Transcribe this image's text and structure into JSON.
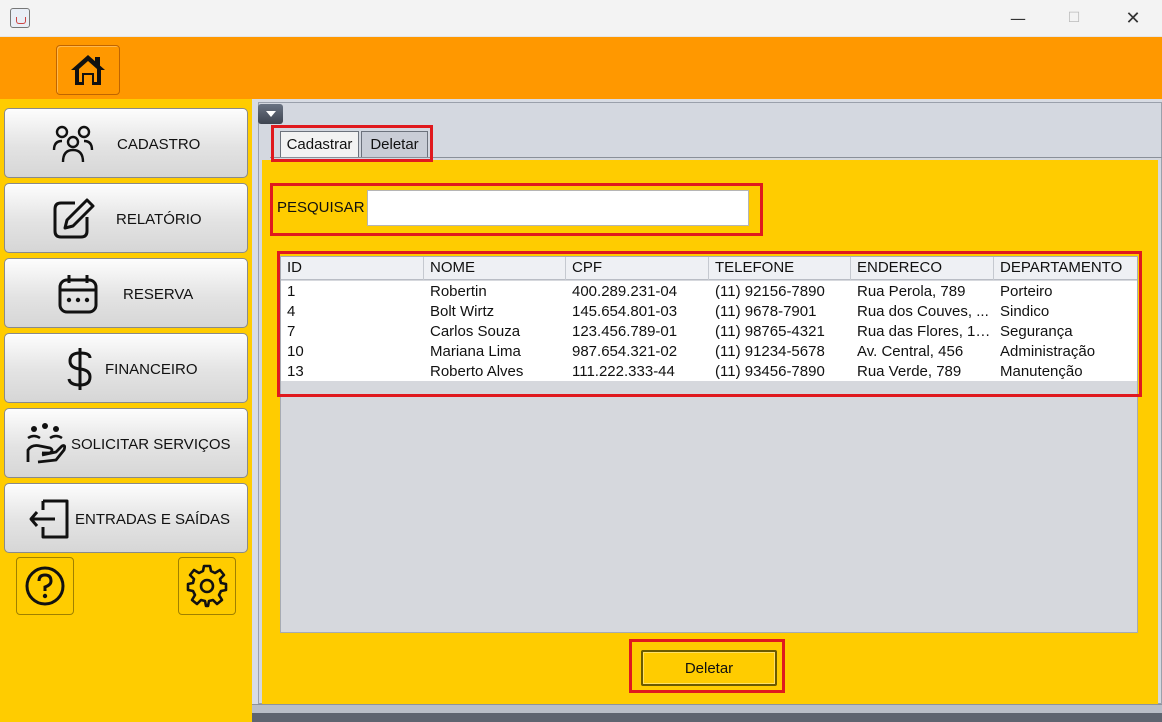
{
  "window": {
    "title": "",
    "min_glyph": "—",
    "max_glyph": "☐",
    "close_glyph": "✕"
  },
  "topbar": {
    "home_icon": "home-icon"
  },
  "sidebar": {
    "items": [
      {
        "label": "CADASTRO",
        "icon": "users-icon"
      },
      {
        "label": "RELATÓRIO",
        "icon": "edit-document-icon"
      },
      {
        "label": "RESERVA",
        "icon": "calendar-icon"
      },
      {
        "label": "FINANCEIRO",
        "icon": "dollar-icon"
      },
      {
        "label": "SOLICITAR SERVIÇOS",
        "icon": "service-hand-icon"
      },
      {
        "label": "ENTRADAS E SAÍDAS",
        "icon": "login-door-icon"
      }
    ],
    "help_icon": "help-icon",
    "settings_icon": "gear-icon"
  },
  "tabs": [
    {
      "label": "Cadastrar",
      "selected": false
    },
    {
      "label": "Deletar",
      "selected": true
    }
  ],
  "search": {
    "label": "PESQUISAR",
    "value": ""
  },
  "table": {
    "columns": [
      "ID",
      "NOME",
      "CPF",
      "TELEFONE",
      "ENDERECO",
      "DEPARTAMENTO"
    ],
    "rows": [
      [
        "1",
        "Robertin",
        "400.289.231-04",
        "(11) 92156-7890",
        "Rua Perola, 789",
        "Porteiro"
      ],
      [
        "4",
        "Bolt Wirtz",
        "145.654.801-03",
        "(11) 9678-7901",
        "Rua dos Couves, ...",
        "Sindico"
      ],
      [
        "7",
        "Carlos Souza",
        "123.456.789-01",
        "(11) 98765-4321",
        "Rua das Flores, 12...",
        "Segurança"
      ],
      [
        "10",
        "Mariana Lima",
        "987.654.321-02",
        "(11) 91234-5678",
        "Av. Central, 456",
        "Administração"
      ],
      [
        "13",
        "Roberto Alves",
        "111.222.333-44",
        "(11) 93456-7890",
        "Rua Verde, 789",
        "Manutenção"
      ]
    ]
  },
  "actions": {
    "delete_label": "Deletar"
  },
  "colors": {
    "top_bar": "#ff9800",
    "sidebar": "#ffcc00",
    "content": "#ffcc00",
    "highlight": "#e0191e"
  }
}
